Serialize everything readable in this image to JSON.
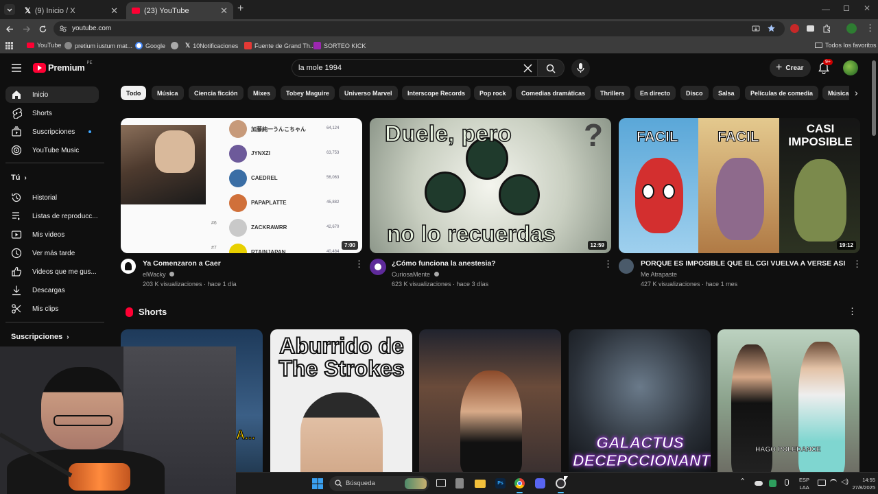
{
  "browser": {
    "tabs": [
      {
        "title": "(9) Inicio / X"
      },
      {
        "title": "(23) YouTube"
      }
    ],
    "url": "youtube.com",
    "bookmarks": [
      "YouTube",
      "pretium iustum mat...",
      "Google",
      "",
      "10Notificaciones",
      "Fuente de Grand Th...",
      "SORTEO KICK"
    ],
    "all_bookmarks": "Todos los favoritos"
  },
  "youtube": {
    "logo_text": "Premium",
    "region": "PE",
    "search_value": "la mole 1994",
    "create_label": "Crear",
    "notif_badge": "9+",
    "sidebar": {
      "main": [
        "Inicio",
        "Shorts",
        "Suscripciones",
        "YouTube Music"
      ],
      "you_header": "Tú",
      "you": [
        "Historial",
        "Listas de reproducc...",
        "Mis videos",
        "Ver más tarde",
        "Videos que me gus...",
        "Descargas",
        "Mis clips"
      ],
      "subs_header": "Suscripciones"
    },
    "chips": [
      "Todo",
      "Música",
      "Ciencia ficción",
      "Mixes",
      "Tobey Maguire",
      "Universo Marvel",
      "Interscope Records",
      "Pop rock",
      "Comedias dramáticas",
      "Thrillers",
      "En directo",
      "Disco",
      "Salsa",
      "Películas de comedia",
      "Música"
    ],
    "videos": [
      {
        "title": "Ya Comenzaron a Caer",
        "channel": "elWacky",
        "meta": "203 K visualizaciones · hace 1 día",
        "duration": "7:00",
        "thumb_rows": [
          "加藤純一うんこちゃん",
          "JYNXZI",
          "CAEDREL",
          "PAPAPLATTE",
          "ZACKRAWRR",
          "RTAINJAPAN"
        ],
        "thumb_nums": [
          "64,124",
          "63,753",
          "56,063",
          "45,882",
          "42,670",
          "40,484"
        ],
        "thumb_ranks": [
          "#6",
          "#7"
        ]
      },
      {
        "title": "¿Cómo funciona la anestesia?",
        "channel": "CuriosaMente",
        "meta": "623 K visualizaciones · hace 3 días",
        "duration": "12:59",
        "thumb_top": "Duele, pero",
        "thumb_bottom": "no lo recuerdas",
        "thumb_mark": "?"
      },
      {
        "title": "PORQUE ES IMPOSIBLE QUE EL CGI VUELVA A VERSE ASI",
        "channel": "Me Atrapaste",
        "meta": "427 K visualizaciones · hace 1 mes",
        "duration": "19:12",
        "thumb_labels": [
          "FACIL",
          "FACIL",
          "CASI IMPOSIBLE"
        ]
      }
    ],
    "shorts_title": "Shorts",
    "shorts": [
      {
        "overlay": "A..."
      },
      {
        "overlay": "Aburrido de The Strokes"
      },
      {
        "overlay": ""
      },
      {
        "overlay": "GALACTUS DECEPCCIONANTE"
      },
      {
        "overlay": "HAGO POLEDANCE"
      }
    ]
  },
  "taskbar": {
    "search_placeholder": "Búsqueda",
    "lang": "ESP",
    "lang_sub": "LAA",
    "time": "14:55",
    "date": "27/8/2025"
  },
  "colors": {
    "yt_red": "#ff0033",
    "accent_blue": "#3ea6ff"
  }
}
